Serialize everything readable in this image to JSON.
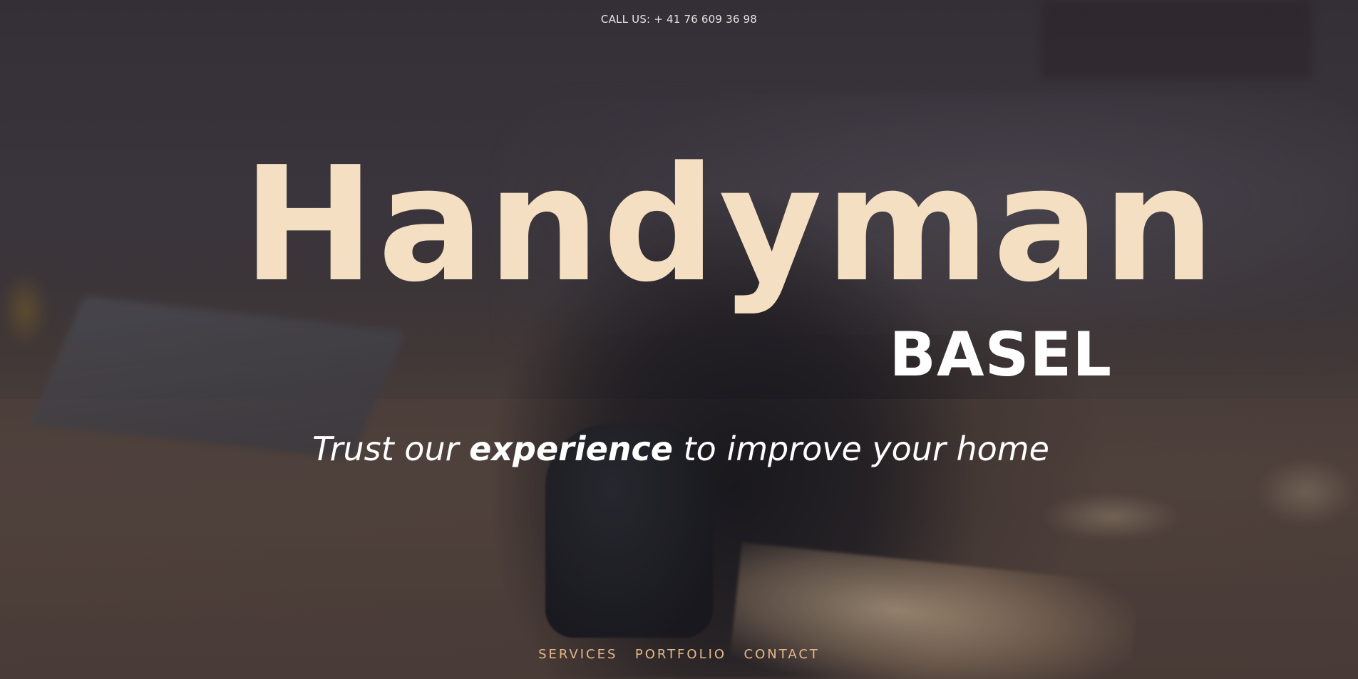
{
  "header": {
    "call_us": "CALL US: + 41 76 609 36 98"
  },
  "hero": {
    "title": "Handyman",
    "subtitle": "BASEL",
    "tagline_before": "Trust our ",
    "tagline_emphasis": "experience",
    "tagline_after": " to improve your home",
    "background_image": "handyman-hand-plane-photo"
  },
  "nav": {
    "items": [
      {
        "label": "SERVICES"
      },
      {
        "label": "PORTFOLIO"
      },
      {
        "label": "CONTACT"
      }
    ]
  },
  "colors": {
    "title": "#f5dfc2",
    "subtitle": "#ffffff",
    "nav_link": "#e6b789",
    "text": "#ffffff"
  }
}
